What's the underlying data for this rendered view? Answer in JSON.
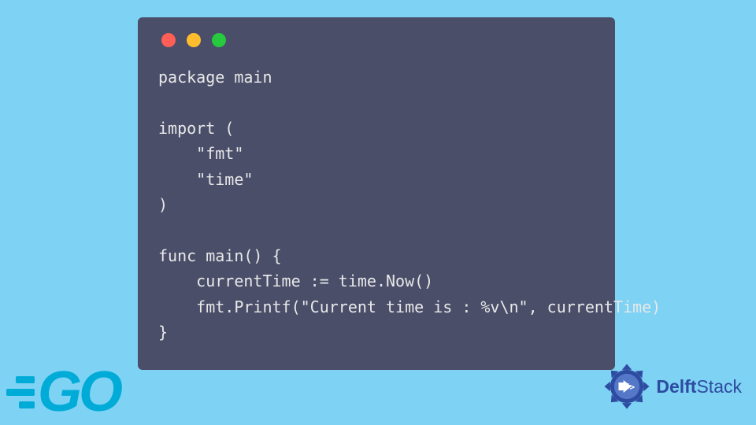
{
  "code": {
    "lines": [
      "package main",
      "",
      "import (",
      "    \"fmt\"",
      "    \"time\"",
      ")",
      "",
      "func main() {",
      "    currentTime := time.Now()",
      "    fmt.Printf(\"Current time is : %v\\n\", currentTime)",
      "}"
    ]
  },
  "logos": {
    "go": "GO",
    "delft_bold": "Delft",
    "delft_rest": "Stack"
  },
  "colors": {
    "background": "#7ed2f4",
    "window": "#4a4e69",
    "code_text": "#e8e8e8",
    "go_brand": "#00acd7",
    "delft_brand": "#2d4ba0"
  }
}
